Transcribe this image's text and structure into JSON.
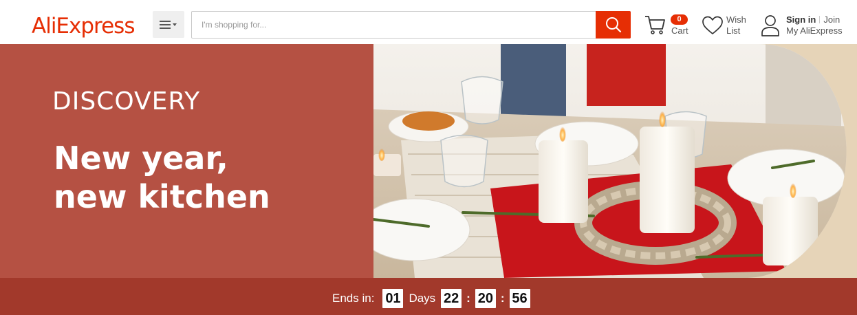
{
  "header": {
    "logo_text": "AliExpress",
    "search": {
      "placeholder": "I'm shopping for..."
    },
    "cart": {
      "count": "0",
      "label": "Cart"
    },
    "wishlist": {
      "line1": "Wish",
      "line2": "List"
    },
    "account": {
      "sign_in": "Sign in",
      "join": "Join",
      "my_account": "My AliExpress"
    }
  },
  "banner": {
    "kicker": "DISCOVERY",
    "headline_line1": "New year,",
    "headline_line2": "new kitchen",
    "background_color": "#b55143"
  },
  "countdown": {
    "label": "Ends in:",
    "days": "01",
    "days_label": "Days",
    "hours": "22",
    "minutes": "20",
    "seconds": "56",
    "background_color": "#a2392b"
  },
  "colors": {
    "brand": "#e62e04"
  },
  "icons": [
    "menu-icon",
    "search-icon",
    "cart-icon",
    "heart-icon",
    "user-icon"
  ]
}
